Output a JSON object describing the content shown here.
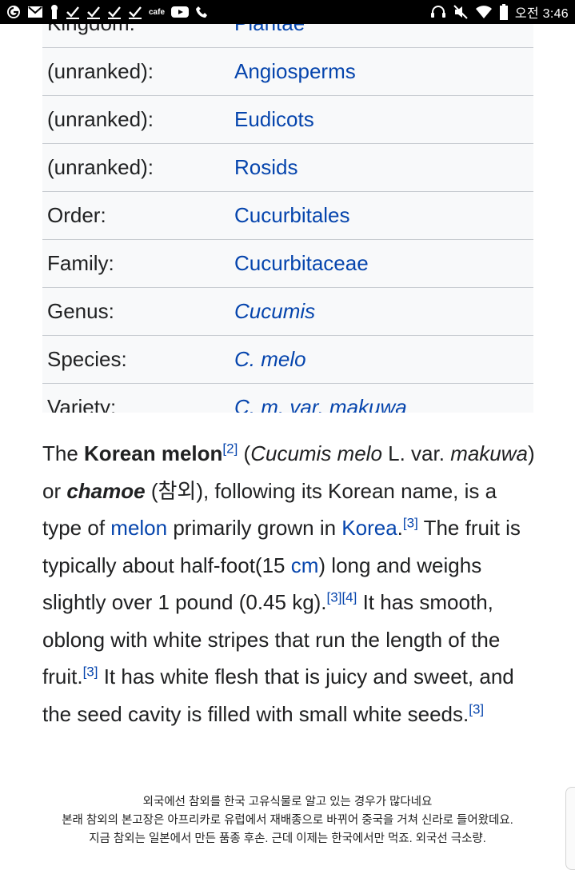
{
  "status_bar": {
    "time": "오전 3:46",
    "cafe_label": "cafe",
    "left_icons": [
      "g-app-icon",
      "gmail-icon",
      "keyhole-icon",
      "check-icon",
      "check-icon",
      "check-icon",
      "check-icon",
      "cafe-icon",
      "youtube-icon",
      "call-icon"
    ],
    "right_icons": [
      "headset-icon",
      "mute-icon",
      "wifi-icon",
      "battery-icon"
    ]
  },
  "taxonomy": {
    "rows": [
      {
        "label": "Kingdom:",
        "value": "Plantae",
        "italic": false
      },
      {
        "label": "(unranked):",
        "value": "Angiosperms",
        "italic": false
      },
      {
        "label": "(unranked):",
        "value": "Eudicots",
        "italic": false
      },
      {
        "label": "(unranked):",
        "value": "Rosids",
        "italic": false
      },
      {
        "label": "Order:",
        "value": "Cucurbitales",
        "italic": false
      },
      {
        "label": "Family:",
        "value": "Cucurbitaceae",
        "italic": false
      },
      {
        "label": "Genus:",
        "value": "Cucumis",
        "italic": true
      },
      {
        "label": "Species:",
        "value": "C. melo",
        "italic": true
      },
      {
        "label": "Variety:",
        "value": "C. m. var. makuwa",
        "italic": true
      }
    ]
  },
  "article": {
    "t1": "The ",
    "b1": "Korean melon",
    "ref2": "[2]",
    "t2": " (",
    "i1": "Cucumis melo",
    "t3": " L. var. ",
    "i2": "makuwa",
    "t4": ") or ",
    "bi1": "chamoe",
    "t5": " (참외), following its Korean name, is a type of ",
    "link_melon": "melon",
    "t6": " primarily grown in ",
    "link_korea": "Korea",
    "t7": ".",
    "ref3a": "[3]",
    "t8": " The fruit is typically about half-foot(15 ",
    "link_cm": "cm",
    "t9": ") long and weighs slightly over 1 pound (0.45 kg).",
    "ref3b": "[3]",
    "ref4": "[4]",
    "t10": " It has smooth, oblong with white stripes that run the length of the fruit.",
    "ref3c": "[3]",
    "t11": " It has white flesh that is juicy and sweet, and the seed cavity is filled with small white seeds.",
    "ref3d": "[3]"
  },
  "caption": {
    "line1": "외국에선 참외를 한국 고유식물로 알고 있는 경우가 많다네요",
    "line2": "본래 참외의 본고장은 아프리카로 유럽에서 재배종으로 바뀌어 중국을 거쳐 신라로 들어왔데요.",
    "line3": "지금 참외는 일본에서 만든 품종 후손. 근데 이제는 한국에서만 먹죠. 외국선 극소량."
  }
}
